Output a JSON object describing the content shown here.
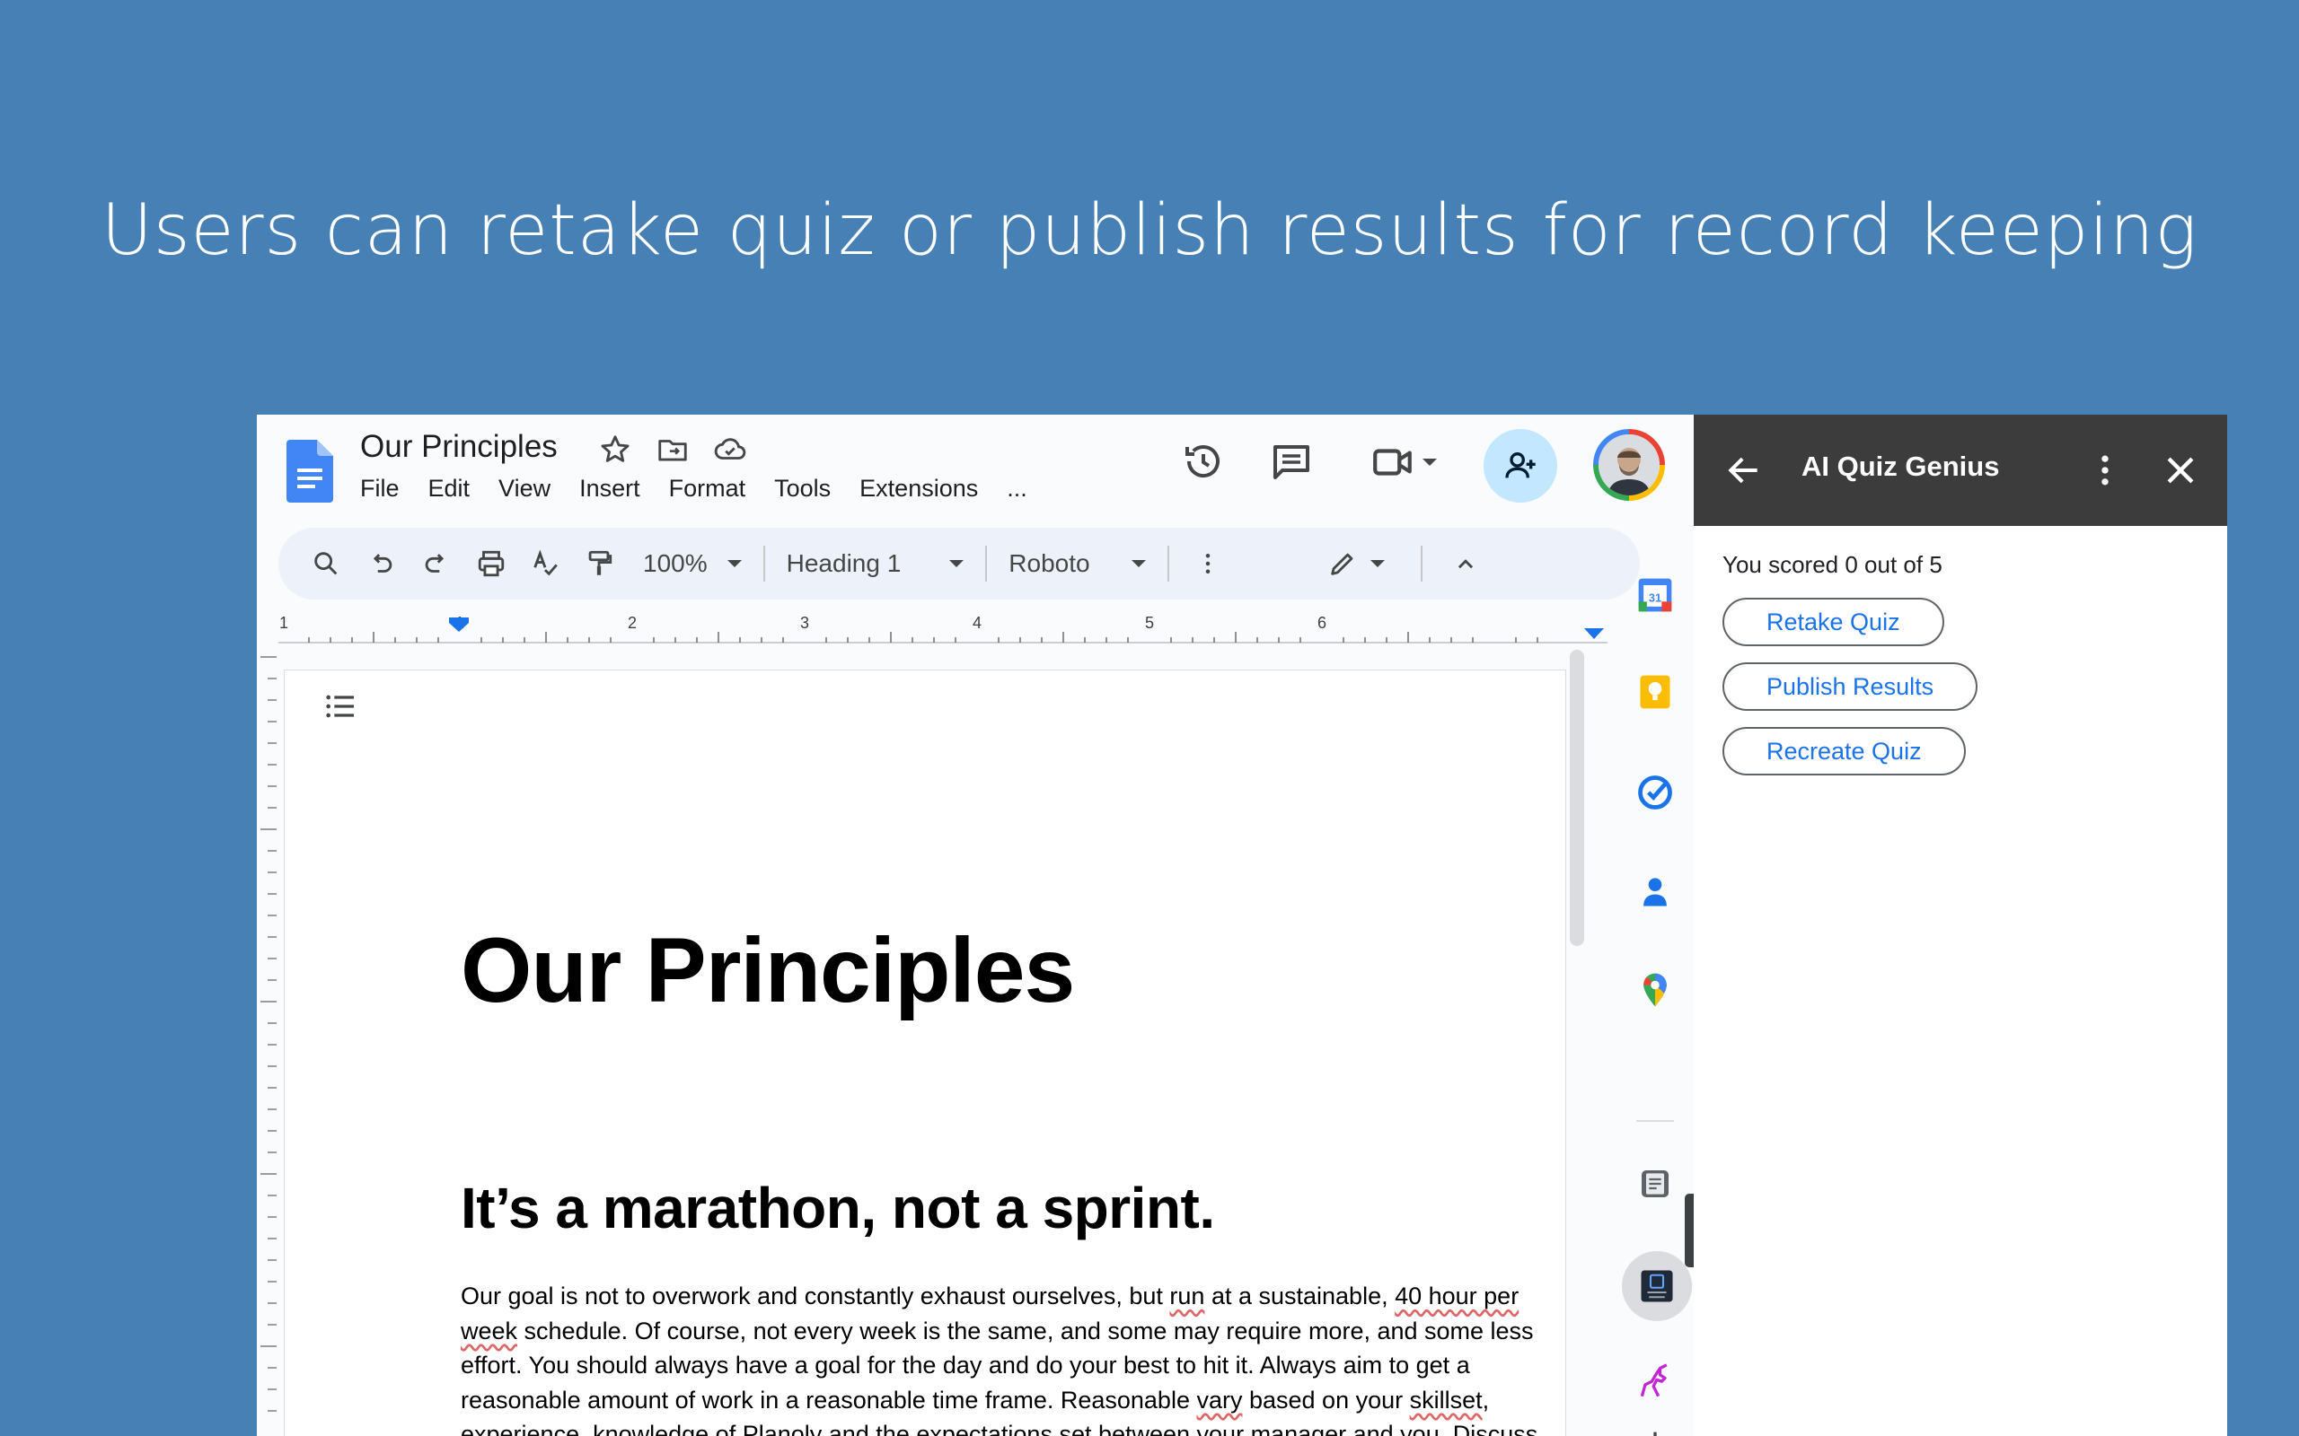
{
  "headline": "Users can retake quiz or publish results for record keeping",
  "docs": {
    "title": "Our Principles",
    "menu": [
      "File",
      "Edit",
      "View",
      "Insert",
      "Format",
      "Tools",
      "Extensions",
      "..."
    ],
    "toolbar": {
      "zoom": "100%",
      "style": "Heading 1",
      "font": "Roboto"
    },
    "ruler_numbers": [
      "1",
      "1",
      "2",
      "3",
      "4",
      "5",
      "6"
    ],
    "content": {
      "heading1": "Our Principles",
      "heading2": "It’s a marathon, not a sprint.",
      "para_parts": [
        "Our goal is not to overwork and constantly exhaust ourselves, but ",
        "run",
        " at a sustainable, ",
        "40 hour per week",
        " schedule. Of course, not every week is the same, and some may require more, and some less effort. You should always have a goal for the day and do your best to hit it. Always aim to get a reasonable amount of work in a reasonable time frame. Reasonable ",
        "vary",
        " based on your ",
        "skillset",
        ", experience, knowledge of Planoly and the expectations set between your manager and you. Discuss"
      ]
    }
  },
  "addon": {
    "title": "AI Quiz Genius",
    "score_text": "You scored 0 out of 5",
    "buttons": {
      "retake": "Retake Quiz",
      "publish": "Publish Results",
      "recreate": "Recreate Quiz"
    }
  },
  "colors": {
    "background": "#4680b5",
    "addon_header": "#3c3c3c",
    "accent_blue": "#1a73e8",
    "share_bg": "#c2e7ff"
  }
}
